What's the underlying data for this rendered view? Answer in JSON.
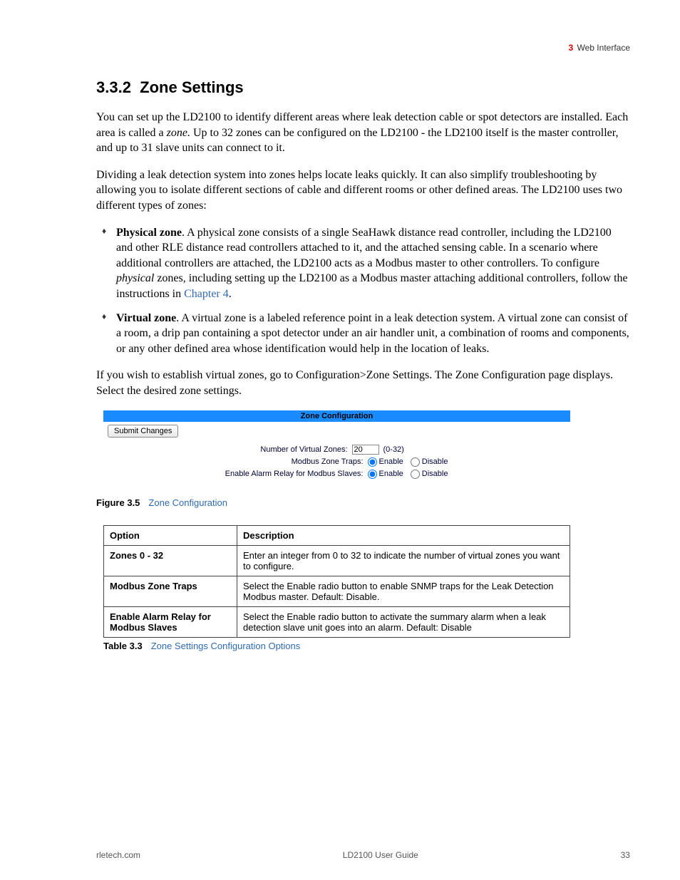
{
  "header": {
    "chapter_num": "3",
    "chapter_title": "Web Interface"
  },
  "section": {
    "number": "3.3.2",
    "title": "Zone Settings"
  },
  "paragraphs": {
    "p1_a": "You can set up the LD2100 to identify different areas where leak detection cable or spot detectors are installed. Each area is called a ",
    "p1_zone": "zone.",
    "p1_b": " Up to 32 zones can be configured on the LD2100 - the LD2100 itself is the master controller, and up to 31 slave units can connect to it.",
    "p2": "Dividing a leak detection system into zones helps locate leaks quickly. It can also simplify troubleshooting by allowing you to isolate different sections of cable and different rooms or other defined areas. The LD2100 uses two different types of zones:",
    "li1_bold": "Physical zone",
    "li1_a": ". A physical zone consists of a single SeaHawk distance read controller, including the LD2100 and other RLE distance read controllers attached to it, and the attached sensing cable. In a scenario where additional controllers are attached, the LD2100 acts as a Modbus master to other controllers. To configure ",
    "li1_phys": "physical",
    "li1_b": " zones, including setting up the LD2100 as a Modbus master attaching additional controllers, follow the instructions in ",
    "li1_link": "Chapter 4",
    "li1_end": ".",
    "li2_bold": "Virtual zone",
    "li2_a": ". A virtual zone is a labeled reference point in a leak detection system. A virtual zone can consist of a room, a drip pan containing a spot detector under an air handler unit, a combination of rooms and components, or any other defined area whose identification would help in the location of leaks.",
    "p3": "If you wish to establish virtual zones, go to Configuration>Zone Settings. The Zone Configuration page displays. Select the desired zone settings."
  },
  "screenshot": {
    "bar": "Zone Configuration",
    "submit": "Submit Changes",
    "row1_label": "Number of Virtual Zones:",
    "row1_value": "20",
    "row1_hint": "(0-32)",
    "row2_label": "Modbus Zone Traps:",
    "row3_label": "Enable Alarm Relay for Modbus Slaves:",
    "enable": "Enable",
    "disable": "Disable"
  },
  "figure": {
    "num": "Figure 3.5",
    "title": "Zone Configuration"
  },
  "table": {
    "h1": "Option",
    "h2": "Description",
    "rows": [
      {
        "opt": "Zones 0 - 32",
        "desc": "Enter an integer from 0 to 32 to indicate the number of virtual zones you want to configure."
      },
      {
        "opt": "Modbus Zone Traps",
        "desc": "Select the Enable radio button to enable SNMP traps for the Leak Detection Modbus master. Default: Disable."
      },
      {
        "opt": "Enable Alarm Relay for Modbus Slaves",
        "desc": "Select the Enable radio button to activate the summary alarm when a leak detection slave unit goes into an alarm. Default: Disable"
      }
    ]
  },
  "tablecaption": {
    "num": "Table 3.3",
    "title": "Zone Settings Configuration Options"
  },
  "footer": {
    "left": "rletech.com",
    "center": "LD2100 User Guide",
    "right": "33"
  }
}
